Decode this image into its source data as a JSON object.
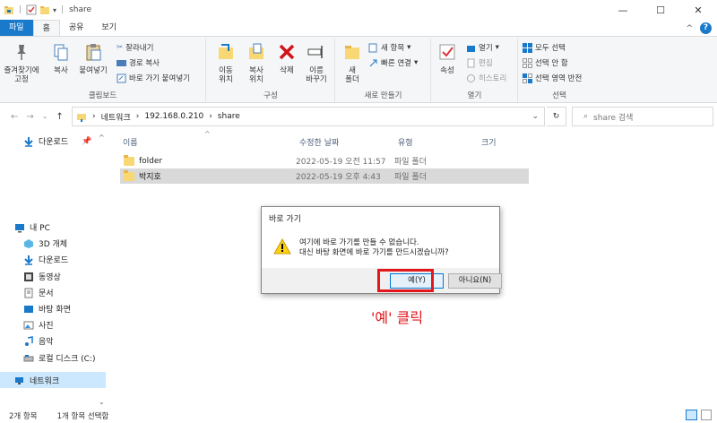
{
  "window": {
    "title": "share",
    "minimize": "—",
    "maximize": "☐",
    "close": "✕"
  },
  "ribbon_tabs": [
    "파일",
    "홈",
    "공유",
    "보기"
  ],
  "ribbon": {
    "clipboard": {
      "label": "클립보드",
      "pin": "즐겨찾기에\n고정",
      "copy": "복사",
      "paste": "붙여넣기",
      "cut": "잘라내기",
      "copy_path": "경로 복사",
      "paste_shortcut": "바로 가기 붙여넣기"
    },
    "organize": {
      "label": "구성",
      "move_to": "이동\n위치",
      "copy_to": "복사\n위치",
      "delete": "삭제",
      "rename": "이름\n바꾸기"
    },
    "new": {
      "label": "새로 만들기",
      "new_folder": "새\n폴더",
      "new_item": "새 항목",
      "easy_access": "빠른 연결"
    },
    "open": {
      "label": "열기",
      "properties": "속성",
      "open": "열기",
      "edit": "편집",
      "history": "히스토리"
    },
    "select": {
      "label": "선택",
      "select_all": "모두 선택",
      "select_none": "선택 안 함",
      "invert": "선택 영역 반전"
    }
  },
  "address": {
    "crumbs": [
      "네트워크",
      "192.168.0.210",
      "share"
    ],
    "search_placeholder": "share 검색"
  },
  "nav_pane": [
    {
      "label": "다운로드",
      "icon": "download-arrow-icon"
    },
    {
      "label": "내 PC",
      "icon": "pc-icon"
    },
    {
      "label": "3D 개체",
      "icon": "cube-icon"
    },
    {
      "label": "다운로드",
      "icon": "download-arrow-icon"
    },
    {
      "label": "동영상",
      "icon": "video-icon"
    },
    {
      "label": "문서",
      "icon": "document-icon"
    },
    {
      "label": "바탕 화면",
      "icon": "desktop-icon"
    },
    {
      "label": "사진",
      "icon": "picture-icon"
    },
    {
      "label": "음악",
      "icon": "music-icon"
    },
    {
      "label": "로컬 디스크 (C:)",
      "icon": "drive-icon"
    },
    {
      "label": "네트워크",
      "icon": "network-icon"
    }
  ],
  "columns": [
    "이름",
    "수정한 날짜",
    "유형",
    "크기"
  ],
  "files": [
    {
      "name": "folder",
      "date": "2022-05-19 오전 11:57",
      "type": "파일 폴더",
      "size": ""
    },
    {
      "name": "박지호",
      "date": "2022-05-19 오후 4:43",
      "type": "파일 폴더",
      "size": ""
    }
  ],
  "status": {
    "count": "2개 항목",
    "selected": "1개 항목 선택함"
  },
  "dialog": {
    "title": "바로 가기",
    "line1": "여기에 바로 가기를 만들 수 없습니다.",
    "line2": "대신 바탕 화면에 바로 가기를 만드시겠습니까?",
    "yes": "예(Y)",
    "no": "아니요(N)"
  },
  "annotation": "'예' 클릭",
  "colors": {
    "accent": "#1979ca",
    "highlight": "#e2171d",
    "selection": "#cce8ff"
  }
}
